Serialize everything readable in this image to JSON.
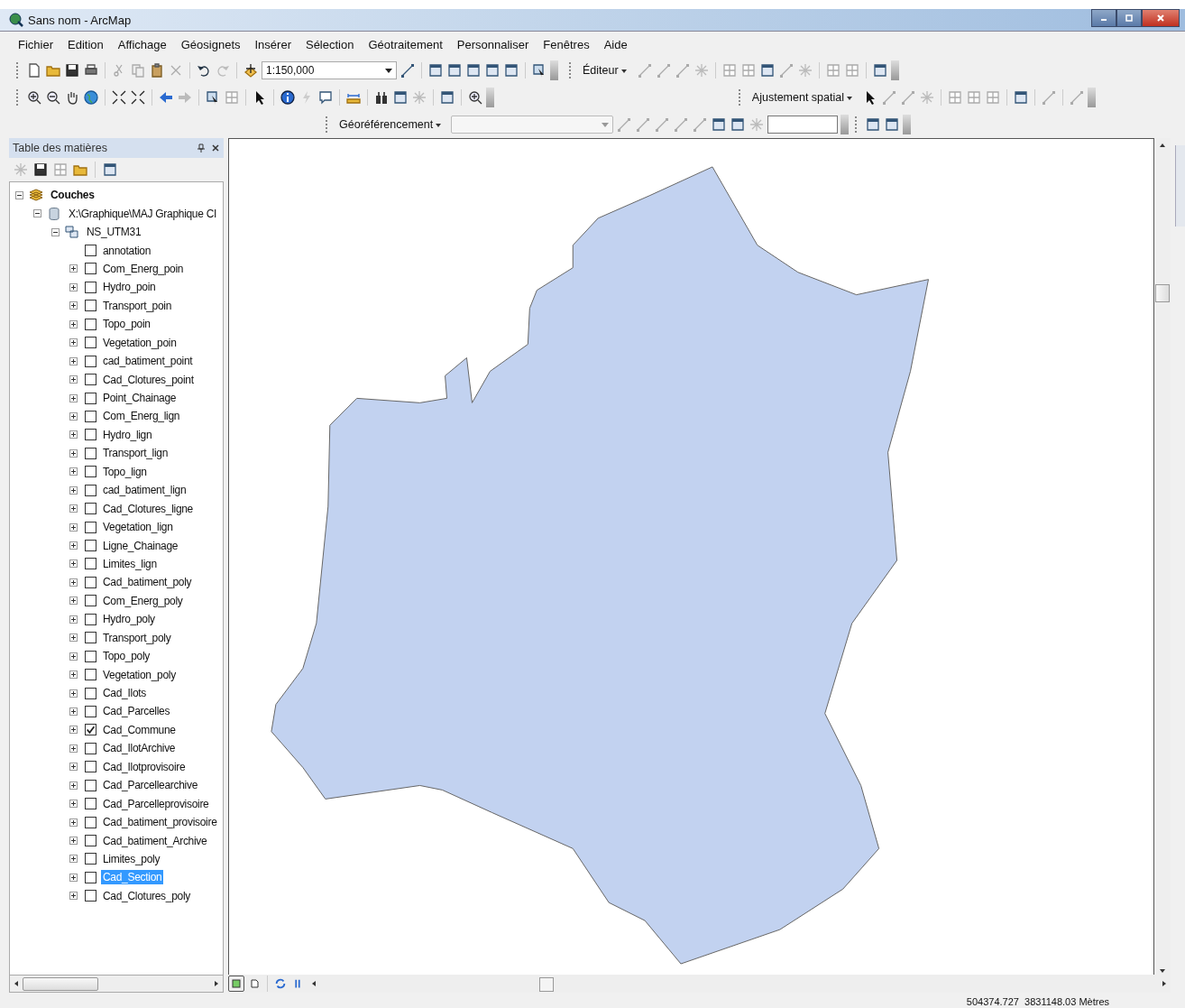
{
  "window": {
    "title": "Sans nom - ArcMap"
  },
  "menu": [
    "Fichier",
    "Edition",
    "Affichage",
    "Géosignets",
    "Insérer",
    "Sélection",
    "Géotraitement",
    "Personnaliser",
    "Fenêtres",
    "Aide"
  ],
  "toolbars": {
    "scale": "1:150,000",
    "editor": "Éditeur",
    "spatial_adjustment": "Ajustement spatial",
    "georeferencing": "Géoréférencement"
  },
  "toc": {
    "title": "Table des matières",
    "root": {
      "label": "Couches",
      "expanded": true,
      "children": [
        {
          "label": "X:\\Graphique\\MAJ Graphique CI",
          "expanded": true,
          "children": [
            {
              "label": "NS_UTM31",
              "expanded": true,
              "children": [
                {
                  "label": "annotation",
                  "expandable": false,
                  "checked": false,
                  "selected": false
                },
                {
                  "label": "Com_Energ_poin",
                  "expandable": true,
                  "checked": false,
                  "selected": false
                },
                {
                  "label": "Hydro_poin",
                  "expandable": true,
                  "checked": false,
                  "selected": false
                },
                {
                  "label": "Transport_poin",
                  "expandable": true,
                  "checked": false,
                  "selected": false
                },
                {
                  "label": "Topo_poin",
                  "expandable": true,
                  "checked": false,
                  "selected": false
                },
                {
                  "label": "Vegetation_poin",
                  "expandable": true,
                  "checked": false,
                  "selected": false
                },
                {
                  "label": "cad_batiment_point",
                  "expandable": true,
                  "checked": false,
                  "selected": false
                },
                {
                  "label": "Cad_Clotures_point",
                  "expandable": true,
                  "checked": false,
                  "selected": false
                },
                {
                  "label": "Point_Chainage",
                  "expandable": true,
                  "checked": false,
                  "selected": false
                },
                {
                  "label": "Com_Energ_lign",
                  "expandable": true,
                  "checked": false,
                  "selected": false
                },
                {
                  "label": "Hydro_lign",
                  "expandable": true,
                  "checked": false,
                  "selected": false
                },
                {
                  "label": "Transport_lign",
                  "expandable": true,
                  "checked": false,
                  "selected": false
                },
                {
                  "label": "Topo_lign",
                  "expandable": true,
                  "checked": false,
                  "selected": false
                },
                {
                  "label": "cad_batiment_lign",
                  "expandable": true,
                  "checked": false,
                  "selected": false
                },
                {
                  "label": "Cad_Clotures_ligne",
                  "expandable": true,
                  "checked": false,
                  "selected": false
                },
                {
                  "label": "Vegetation_lign",
                  "expandable": true,
                  "checked": false,
                  "selected": false
                },
                {
                  "label": "Ligne_Chainage",
                  "expandable": true,
                  "checked": false,
                  "selected": false
                },
                {
                  "label": "Limites_lign",
                  "expandable": true,
                  "checked": false,
                  "selected": false
                },
                {
                  "label": "Cad_batiment_poly",
                  "expandable": true,
                  "checked": false,
                  "selected": false
                },
                {
                  "label": "Com_Energ_poly",
                  "expandable": true,
                  "checked": false,
                  "selected": false
                },
                {
                  "label": "Hydro_poly",
                  "expandable": true,
                  "checked": false,
                  "selected": false
                },
                {
                  "label": "Transport_poly",
                  "expandable": true,
                  "checked": false,
                  "selected": false
                },
                {
                  "label": "Topo_poly",
                  "expandable": true,
                  "checked": false,
                  "selected": false
                },
                {
                  "label": "Vegetation_poly",
                  "expandable": true,
                  "checked": false,
                  "selected": false
                },
                {
                  "label": "Cad_Ilots",
                  "expandable": true,
                  "checked": false,
                  "selected": false
                },
                {
                  "label": "Cad_Parcelles",
                  "expandable": true,
                  "checked": false,
                  "selected": false
                },
                {
                  "label": "Cad_Commune",
                  "expandable": true,
                  "checked": true,
                  "selected": false
                },
                {
                  "label": "Cad_IlotArchive",
                  "expandable": true,
                  "checked": false,
                  "selected": false
                },
                {
                  "label": "Cad_Ilotprovisoire",
                  "expandable": true,
                  "checked": false,
                  "selected": false
                },
                {
                  "label": "Cad_Parcellearchive",
                  "expandable": true,
                  "checked": false,
                  "selected": false
                },
                {
                  "label": "Cad_Parcelleprovisoire",
                  "expandable": true,
                  "checked": false,
                  "selected": false
                },
                {
                  "label": "Cad_batiment_provisoire",
                  "expandable": true,
                  "checked": false,
                  "selected": false
                },
                {
                  "label": "Cad_batiment_Archive",
                  "expandable": true,
                  "checked": false,
                  "selected": false
                },
                {
                  "label": "Limites_poly",
                  "expandable": true,
                  "checked": false,
                  "selected": false
                },
                {
                  "label": "Cad_Section",
                  "expandable": true,
                  "checked": false,
                  "selected": true
                },
                {
                  "label": "Cad_Clotures_poly",
                  "expandable": true,
                  "checked": false,
                  "selected": false
                }
              ]
            }
          ]
        }
      ]
    }
  },
  "status_bar": {
    "coordinates": "504374.727  3831148.03 Mètres"
  }
}
